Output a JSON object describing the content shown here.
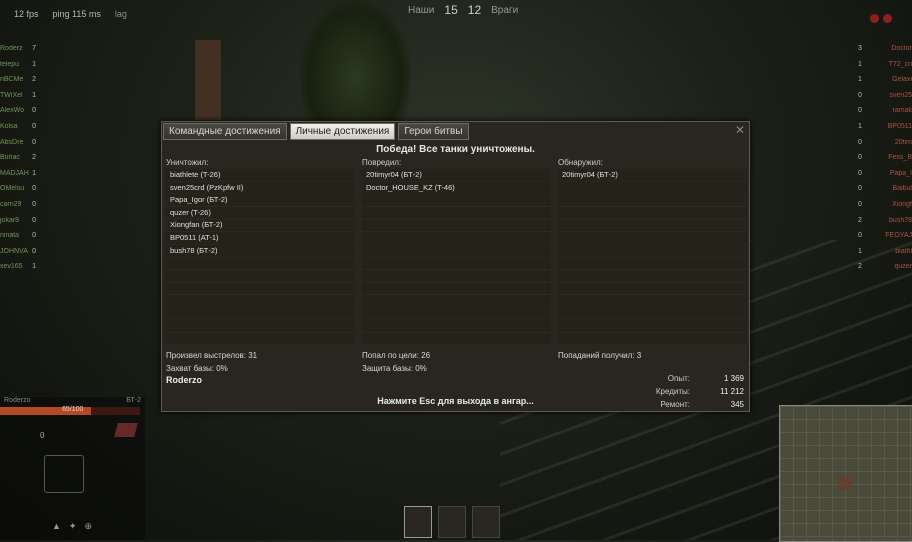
{
  "hud": {
    "fps": "12 fps",
    "ping": "ping 115 ms",
    "lag": "lag",
    "team_label": "Наши",
    "team_score": "15",
    "enemy_score": "12",
    "enemy_label": "Враги"
  },
  "ally_roster": [
    {
      "name": "Roderz",
      "frags": "7"
    },
    {
      "name": "telepu",
      "frags": "1"
    },
    {
      "name": "nBCMe",
      "frags": "2"
    },
    {
      "name": "TWiXel",
      "frags": "1"
    },
    {
      "name": "AlexWo",
      "frags": "0"
    },
    {
      "name": "Kolsa",
      "frags": "0"
    },
    {
      "name": "AbsDre",
      "frags": "0"
    },
    {
      "name": "Buriac",
      "frags": "2"
    },
    {
      "name": "MADJAH",
      "frags": "1"
    },
    {
      "name": "OMelsu",
      "frags": "0"
    },
    {
      "name": "carn29",
      "frags": "0"
    },
    {
      "name": "jokar8",
      "frags": "0"
    },
    {
      "name": "ninata",
      "frags": "0"
    },
    {
      "name": "JOHNVA",
      "frags": "0"
    },
    {
      "name": "xev165",
      "frags": "1"
    }
  ],
  "enemy_roster": [
    {
      "name": "Doctor",
      "frags": "3"
    },
    {
      "name": "T72_cn",
      "frags": "1"
    },
    {
      "name": "Gelaxi",
      "frags": "1"
    },
    {
      "name": "sven25",
      "frags": "0"
    },
    {
      "name": "ramak",
      "frags": "0"
    },
    {
      "name": "BP0511",
      "frags": "1"
    },
    {
      "name": "20tim",
      "frags": "0"
    },
    {
      "name": "Fess_B",
      "frags": "0"
    },
    {
      "name": "Papa_I",
      "frags": "0"
    },
    {
      "name": "Baibul",
      "frags": "0"
    },
    {
      "name": "Xiongf",
      "frags": "0"
    },
    {
      "name": "bush78",
      "frags": "2"
    },
    {
      "name": "FEOYAJ",
      "frags": "0"
    },
    {
      "name": "biathl",
      "frags": "1"
    },
    {
      "name": "quzer",
      "frags": "2"
    }
  ],
  "tank_panel": {
    "player": "Roderzo",
    "tank_class": "БТ-2",
    "hp_text": "65/100",
    "hp_fraction": 0.65,
    "count": "0"
  },
  "results": {
    "tabs": [
      "Командные достижения",
      "Личные достижения",
      "Герои битвы"
    ],
    "active_tab": 1,
    "banner": "Победа! Все танки уничтожены.",
    "killed_header": "Уничтожил:",
    "killed": [
      "biathlete (T-26)",
      "sven25crd (PzKpfw II)",
      "Papa_Igor (БТ-2)",
      "quzer (T-26)",
      "Xiongfan (БТ-2)",
      "BP0511 (AT-1)",
      "bush78 (БТ-2)"
    ],
    "damaged_header": "Повредил:",
    "damaged": [
      "20timyr04 (БТ-2)",
      "Doctor_HOUSE_KZ (T-46)"
    ],
    "spotted_header": "Обнаружил:",
    "spotted": [
      "20timyr04 (БТ-2)"
    ],
    "shots": "Произвел выстрелов: 31",
    "capture": "Захват базы: 0%",
    "hits": "Попал по цели: 26",
    "defense": "Защита базы: 0%",
    "received": "Попаданий получил: 3",
    "player": "Roderzo",
    "exit_hint": "Нажмите Esc для выхода в ангар...",
    "rewards": [
      {
        "label": "Опыт:",
        "value": "1 369"
      },
      {
        "label": "Кредиты:",
        "value": "11 212"
      },
      {
        "label": "Ремонт:",
        "value": "345"
      }
    ]
  }
}
